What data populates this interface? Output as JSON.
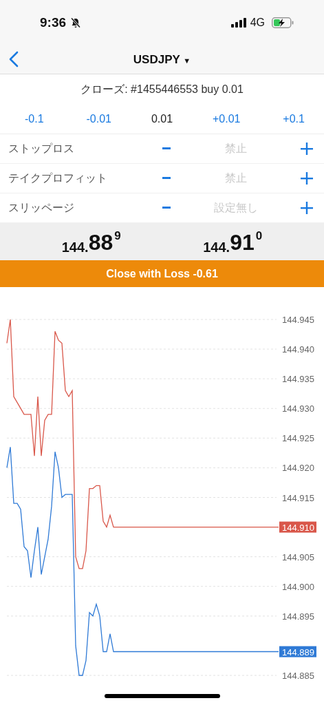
{
  "status_bar": {
    "time": "9:36",
    "network": "4G"
  },
  "nav": {
    "title": "USDJPY",
    "caret": "▼"
  },
  "order": {
    "text": "クローズ: #1455446553 buy 0.01"
  },
  "volume": {
    "steps": [
      {
        "label": "-0.1",
        "kind": "step"
      },
      {
        "label": "-0.01",
        "kind": "step"
      },
      {
        "label": "0.01",
        "kind": "value"
      },
      {
        "label": "+0.01",
        "kind": "step"
      },
      {
        "label": "+0.1",
        "kind": "step"
      }
    ]
  },
  "settings": [
    {
      "label": "ストップロス",
      "value": "禁止"
    },
    {
      "label": "テイクプロフィット",
      "value": "禁止"
    },
    {
      "label": "スリッページ",
      "value": "設定無し"
    }
  ],
  "prices": [
    {
      "prefix": "144.",
      "big": "88",
      "pip": "9"
    },
    {
      "prefix": "144.",
      "big": "91",
      "pip": "0"
    }
  ],
  "close_button": {
    "label": "Close with Loss -0.61"
  },
  "chart": {
    "chart_data": {
      "type": "line",
      "grid": true,
      "ylim": [
        144.885,
        144.945
      ],
      "yticks": [
        {
          "value": 144.945,
          "label": "144.945"
        },
        {
          "value": 144.94,
          "label": "144.940"
        },
        {
          "value": 144.935,
          "label": "144.935"
        },
        {
          "value": 144.93,
          "label": "144.930"
        },
        {
          "value": 144.925,
          "label": "144.925"
        },
        {
          "value": 144.92,
          "label": "144.920"
        },
        {
          "value": 144.915,
          "label": "144.915"
        },
        {
          "value": 144.905,
          "label": "144.905"
        },
        {
          "value": 144.9,
          "label": "144.900"
        },
        {
          "value": 144.895,
          "label": "144.895"
        },
        {
          "value": 144.885,
          "label": "144.885"
        }
      ],
      "categories": [
        null,
        null,
        null,
        null,
        null,
        null,
        null,
        null,
        null,
        null,
        null,
        null,
        null,
        null,
        null,
        null,
        null,
        null,
        null,
        null,
        null,
        null,
        null,
        null,
        null,
        null,
        null,
        null,
        null,
        null,
        null,
        null,
        null,
        null,
        null,
        null,
        null,
        null,
        null,
        null,
        null,
        null,
        null,
        null,
        null,
        null,
        null,
        null,
        null,
        null,
        null,
        null,
        null,
        null,
        null,
        null,
        null,
        null,
        null,
        null,
        null,
        null,
        null,
        null,
        null,
        null,
        null,
        null,
        null,
        null,
        null,
        null,
        null,
        null,
        null,
        null,
        null,
        null,
        null,
        null
      ],
      "series": [
        {
          "color": "#d9574a",
          "values": [
            144.941,
            144.945,
            144.932,
            144.931,
            144.93,
            144.929,
            144.929,
            144.929,
            144.922,
            144.932,
            144.922,
            144.928,
            144.929,
            144.929,
            144.943,
            144.9415,
            144.941,
            144.933,
            144.932,
            144.933,
            144.905,
            144.903,
            144.903,
            144.906,
            144.9165,
            144.9165,
            144.917,
            144.917,
            144.911,
            144.91,
            144.912,
            144.91,
            144.91,
            144.91,
            144.91,
            144.91,
            144.91,
            144.91,
            144.91,
            144.91,
            144.91,
            144.91,
            144.91,
            144.91,
            144.91,
            144.91,
            144.91,
            144.91,
            144.91,
            144.91,
            144.91,
            144.91,
            144.91,
            144.91,
            144.91,
            144.91,
            144.91,
            144.91,
            144.91,
            144.91,
            144.91,
            144.91,
            144.91,
            144.91,
            144.91,
            144.91,
            144.91,
            144.91,
            144.91,
            144.91,
            144.91,
            144.91,
            144.91,
            144.91,
            144.91,
            144.91,
            144.91,
            144.91,
            144.91,
            144.91
          ]
        },
        {
          "color": "#2f7ad6",
          "values": [
            144.92,
            144.9235,
            144.914,
            144.914,
            144.913,
            144.9067,
            144.906,
            144.9015,
            144.906,
            144.91,
            144.902,
            144.905,
            144.908,
            144.9135,
            144.9227,
            144.92,
            144.915,
            144.9155,
            144.9155,
            144.9155,
            144.89,
            144.885,
            144.885,
            144.8875,
            144.8956,
            144.895,
            144.897,
            144.895,
            144.889,
            144.889,
            144.892,
            144.889,
            144.889,
            144.889,
            144.889,
            144.889,
            144.889,
            144.889,
            144.889,
            144.889,
            144.889,
            144.889,
            144.889,
            144.889,
            144.889,
            144.889,
            144.889,
            144.889,
            144.889,
            144.889,
            144.889,
            144.889,
            144.889,
            144.889,
            144.889,
            144.889,
            144.889,
            144.889,
            144.889,
            144.889,
            144.889,
            144.889,
            144.889,
            144.889,
            144.889,
            144.889,
            144.889,
            144.889,
            144.889,
            144.889,
            144.889,
            144.889,
            144.889,
            144.889,
            144.889,
            144.889,
            144.889,
            144.889,
            144.889,
            144.889
          ]
        }
      ]
    },
    "price_tags": [
      {
        "text": "144.910"
      },
      {
        "text": "144.889"
      }
    ]
  }
}
